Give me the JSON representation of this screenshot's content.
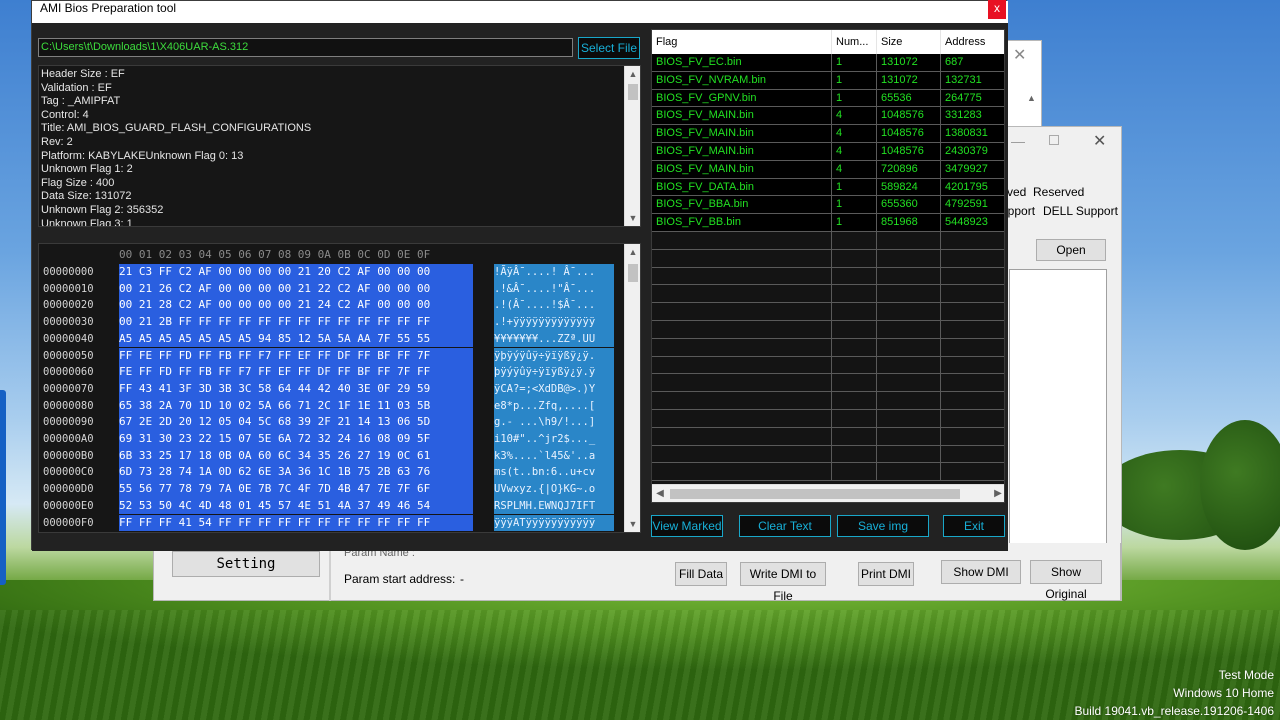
{
  "window": {
    "title": "AMI Bios Preparation tool",
    "close_glyph": "x"
  },
  "path_field": {
    "value": "C:\\Users\\t\\Downloads\\1\\X406UAR-AS.312"
  },
  "buttons": {
    "select_file": "Select File",
    "view_marked": "View Marked",
    "clear_text": "Clear Text",
    "save_img": "Save img",
    "exit": "Exit"
  },
  "info_lines": [
    "Header Size : EF",
    "Validation : EF",
    "Tag : _AMIPFAT",
    "Control: 4",
    "Title: AMI_BIOS_GUARD_FLASH_CONFIGURATIONS",
    "Rev: 2",
    "Platform: KABYLAKEUnknown Flag 0: 13",
    "Unknown Flag 1: 2",
    "Flag Size : 400",
    "Data Size: 131072",
    "Unknown Flag 2: 356352",
    "Unknown Flag 3: 1"
  ],
  "hex": {
    "header": "00 01 02 03 04 05 06 07 08 09 0A 0B 0C 0D 0E 0F",
    "rows": [
      {
        "addr": "00000000",
        "bytes": "21 C3 FF C2 AF 00 00 00 00 21 20 C2 AF 00 00 00",
        "ascii": "!ÃÿÂ¯....! Â¯..."
      },
      {
        "addr": "00000010",
        "bytes": "00 21 26 C2 AF 00 00 00 00 21 22 C2 AF 00 00 00",
        "ascii": ".!&Â¯....!\"Â¯..."
      },
      {
        "addr": "00000020",
        "bytes": "00 21 28 C2 AF 00 00 00 00 21 24 C2 AF 00 00 00",
        "ascii": ".!(Â¯....!$Â¯..."
      },
      {
        "addr": "00000030",
        "bytes": "00 21 2B FF FF FF FF FF FF FF FF FF FF FF FF FF",
        "ascii": ".!+ÿÿÿÿÿÿÿÿÿÿÿÿÿ"
      },
      {
        "addr": "00000040",
        "bytes": "A5 A5 A5 A5 A5 A5 A5 94 85 12 5A 5A AA 7F 55 55",
        "ascii": "¥¥¥¥¥¥¥...ZZª.UU"
      },
      {
        "addr": "00000050",
        "bytes": "FF FE FF FD FF FB FF F7 FF EF FF DF FF BF FF 7F",
        "ascii": "ÿþÿýÿûÿ÷ÿïÿßÿ¿ÿ."
      },
      {
        "addr": "00000060",
        "bytes": "FE FF FD FF FB FF F7 FF EF FF DF FF BF FF 7F FF",
        "ascii": "þÿýÿûÿ÷ÿïÿßÿ¿ÿ.ÿ"
      },
      {
        "addr": "00000070",
        "bytes": "FF 43 41 3F 3D 3B 3C 58 64 44 42 40 3E 0F 29 59",
        "ascii": "ÿCA?=;<XdDB@>.)Y"
      },
      {
        "addr": "00000080",
        "bytes": "65 38 2A 70 1D 10 02 5A 66 71 2C 1F 1E 11 03 5B",
        "ascii": "e8*p...Zfq,....["
      },
      {
        "addr": "00000090",
        "bytes": "67 2E 2D 20 12 05 04 5C 68 39 2F 21 14 13 06 5D",
        "ascii": "g.- ...\\h9/!...]"
      },
      {
        "addr": "000000A0",
        "bytes": "69 31 30 23 22 15 07 5E 6A 72 32 24 16 08 09 5F",
        "ascii": "i10#\"..^jr2$..._"
      },
      {
        "addr": "000000B0",
        "bytes": "6B 33 25 17 18 0B 0A 60 6C 34 35 26 27 19 0C 61",
        "ascii": "k3%....`l45&'..a"
      },
      {
        "addr": "000000C0",
        "bytes": "6D 73 28 74 1A 0D 62 6E 3A 36 1C 1B 75 2B 63 76",
        "ascii": "ms(t..bn:6..u+cv"
      },
      {
        "addr": "000000D0",
        "bytes": "55 56 77 78 79 7A 0E 7B 7C 4F 7D 4B 47 7E 7F 6F",
        "ascii": "UVwxyz.{|O}KG~.o"
      },
      {
        "addr": "000000E0",
        "bytes": "52 53 50 4C 4D 48 01 45 57 4E 51 4A 37 49 46 54",
        "ascii": "RSPLMH.EWNQJ7IFT"
      },
      {
        "addr": "000000F0",
        "bytes": "FF FF FF 41 54 FF FF FF FF FF FF FF FF FF FF FF",
        "ascii": "ÿÿÿATÿÿÿÿÿÿÿÿÿÿÿ"
      }
    ]
  },
  "flag_table": {
    "headers": [
      "Flag",
      "Num...",
      "Size",
      "Address"
    ],
    "rows": [
      [
        "BIOS_FV_EC.bin",
        "1",
        "131072",
        "687"
      ],
      [
        "BIOS_FV_NVRAM.bin",
        "1",
        "131072",
        "132731"
      ],
      [
        "BIOS_FV_GPNV.bin",
        "1",
        "65536",
        "264775"
      ],
      [
        "BIOS_FV_MAIN.bin",
        "4",
        "1048576",
        "331283"
      ],
      [
        "BIOS_FV_MAIN.bin",
        "4",
        "1048576",
        "1380831"
      ],
      [
        "BIOS_FV_MAIN.bin",
        "4",
        "1048576",
        "2430379"
      ],
      [
        "BIOS_FV_MAIN.bin",
        "4",
        "720896",
        "3479927"
      ],
      [
        "BIOS_FV_DATA.bin",
        "1",
        "589824",
        "4201795"
      ],
      [
        "BIOS_FV_BBA.bin",
        "1",
        "655360",
        "4792591"
      ],
      [
        "BIOS_FV_BB.bin",
        "1",
        "851968",
        "5448923"
      ]
    ]
  },
  "background_window": {
    "labels": {
      "ved": "ved",
      "reserved": "Reserved",
      "upport": "upport",
      "dell_support": "DELL Support",
      "open": "Open"
    },
    "setting": "Setting",
    "param_name": "Param Name :",
    "param_start": "Param start address:",
    "param_start_value": "-",
    "buttons": {
      "fill_data": "Fill Data",
      "write_dmi": "Write DMI to File",
      "print_dmi": "Print DMI",
      "show_dmi": "Show  DMI",
      "show_original": "Show Original"
    }
  },
  "watermark": {
    "line1": "Test Mode",
    "line2": "Windows 10 Home",
    "line3": "Build 19041.vb_release.191206-1406"
  },
  "colors": {
    "hex_highlight": "#2a5fe0",
    "ascii_highlight": "#2a86c8",
    "flag_text": "#22e022",
    "button_accent": "#18b0d8"
  }
}
